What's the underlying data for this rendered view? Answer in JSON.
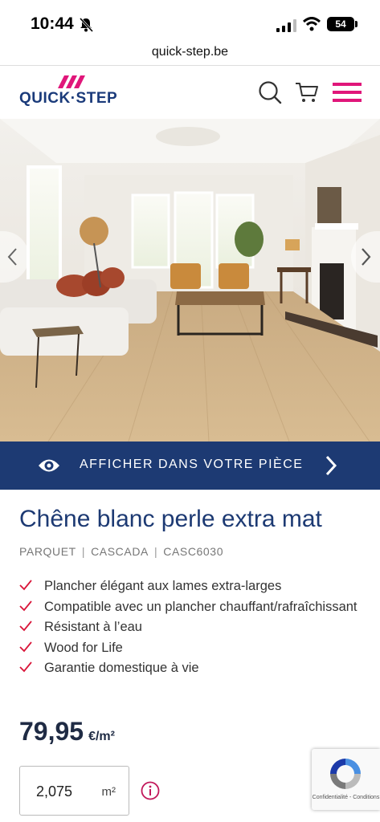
{
  "status_bar": {
    "time": "10:44",
    "battery": "54"
  },
  "browser": {
    "url": "quick-step.be"
  },
  "header": {
    "logo_text": "QUICK·STEP",
    "brand_color": "#e0167a",
    "brand_blue": "#1a3a7a",
    "icons": [
      "search-icon",
      "cart-icon",
      "hamburger-menu-icon"
    ]
  },
  "hero": {
    "alt": "",
    "controls": [
      "chevron-left-icon",
      "chevron-right-icon"
    ]
  },
  "view_in_room": {
    "label": "AFFICHER DANS VOTRE PIÈCE",
    "background": "#1d3a73"
  },
  "product": {
    "title": "Chêne blanc perle extra mat",
    "breadcrumb": [
      "PARQUET",
      "CASCADA",
      "CASC6030"
    ],
    "features": [
      "Plancher élégant aux lames extra-larges",
      "Compatible avec un plancher chauffant/rafraîchissant",
      "Résistant à l’eau",
      "Wood for Life",
      "Garantie domestique à vie"
    ],
    "price": "79,95",
    "price_unit": "€/m²",
    "quantity": "2,075",
    "quantity_unit": "m²"
  },
  "recaptcha": {
    "links": "Confidentialité - Conditions"
  }
}
